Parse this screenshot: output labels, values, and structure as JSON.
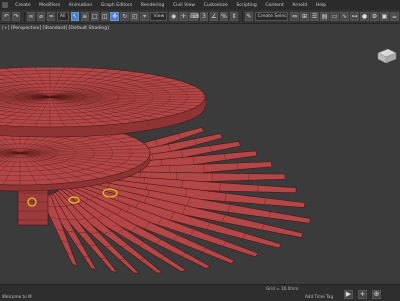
{
  "menubar": {
    "items": [
      "Create",
      "Modifiers",
      "Animation",
      "Graph Editors",
      "Rendering",
      "Civil View",
      "Customize",
      "Scripting",
      "Content",
      "Arnold",
      "Help"
    ]
  },
  "toolbar": {
    "selection_filter": "All",
    "view_dropdown": "View",
    "named_selection": "Create Selection Se"
  },
  "viewport": {
    "label": "[+] [Perspective] [Standard] [Default Shading]",
    "colors": {
      "background": "#3b3b3b",
      "mesh_fill": "#b34747",
      "mesh_edge": "#4a1414",
      "selection_highlight": "#e0c020"
    },
    "blade_count": 20
  },
  "statusbar": {
    "left_text": "Welcome to M",
    "coord_text": "Grid = 10.0mm",
    "time_tag": "Add Time Tag",
    "icons": [
      "play-icon",
      "zoom-icon",
      "orbit-icon"
    ]
  }
}
